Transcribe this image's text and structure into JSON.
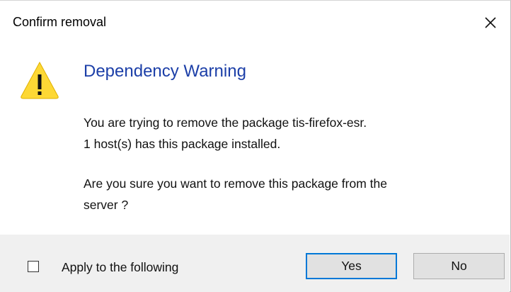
{
  "window": {
    "title": "Confirm removal",
    "close_icon": "close-icon"
  },
  "content": {
    "icon": "warning-icon",
    "heading": "Dependency Warning",
    "line1": "You are trying to remove the package tis-firefox-esr.",
    "line2": "1 host(s) has this package installed.",
    "line3": "Are you sure you want to remove this package from the",
    "line4": "server ?"
  },
  "footer": {
    "checkbox_label": "Apply to the following",
    "checkbox_checked": false,
    "yes_label": "Yes",
    "no_label": "No"
  },
  "colors": {
    "heading": "#1c3fa8",
    "warning_fill": "#fdd835",
    "default_button_border": "#0078d7",
    "footer_bg": "#f0f0f0"
  }
}
